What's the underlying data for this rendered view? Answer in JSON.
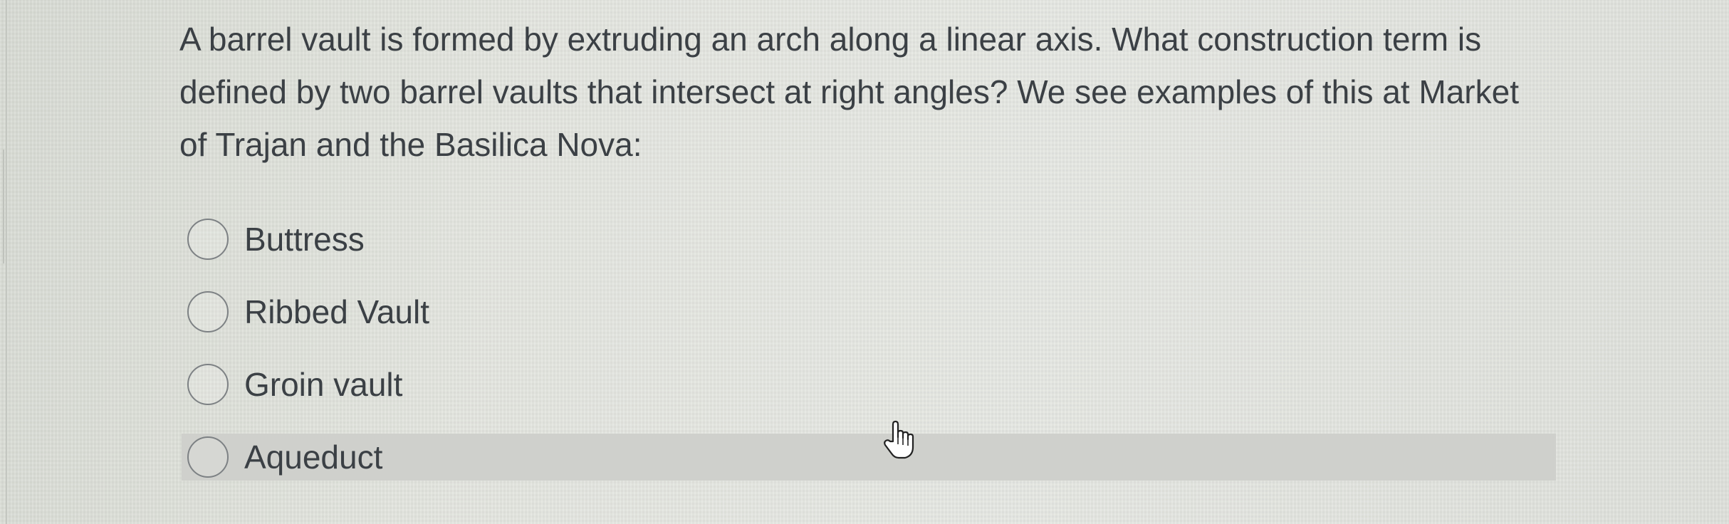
{
  "question": {
    "text": "A barrel vault is formed by extruding an arch along a linear axis. What construction term is defined by two barrel vaults that intersect at right angles? We see examples of this at Market of Trajan and the Basilica Nova:"
  },
  "options": [
    {
      "label": "Buttress",
      "selected": false
    },
    {
      "label": "Ribbed Vault",
      "selected": false
    },
    {
      "label": "Groin vault",
      "selected": false
    },
    {
      "label": "Aqueduct",
      "selected": false,
      "hovered": true
    }
  ],
  "colors": {
    "text": "#3b4045",
    "hover_background": "#cfd0cc",
    "radio_border": "#7d8184"
  },
  "cursor": {
    "icon": "hand-pointer-icon"
  }
}
